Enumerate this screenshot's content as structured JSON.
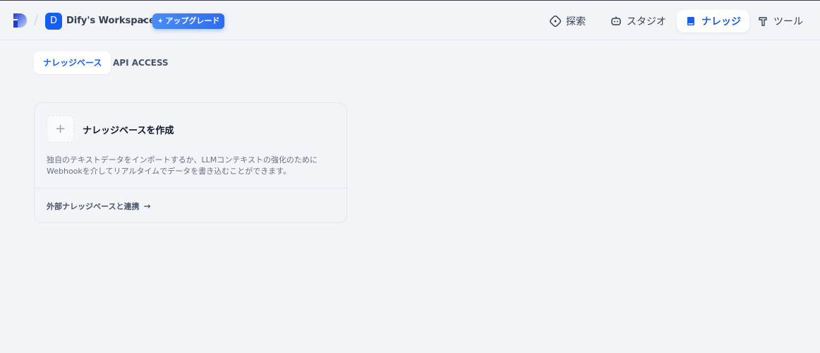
{
  "header": {
    "workspace_initial": "D",
    "workspace_name": "Dify's Workspace",
    "upgrade_label": "アップグレード",
    "nav": [
      {
        "label": "探索",
        "icon": "compass-icon",
        "active": false
      },
      {
        "label": "スタジオ",
        "icon": "robot-icon",
        "active": false
      },
      {
        "label": "ナレッジ",
        "icon": "book-icon",
        "active": true
      },
      {
        "label": "ツール",
        "icon": "hammer-icon",
        "active": false
      }
    ]
  },
  "tabs": [
    {
      "label": "ナレッジベース",
      "active": true
    },
    {
      "label": "API ACCESS",
      "active": false
    }
  ],
  "create_card": {
    "plus": "+",
    "title": "ナレッジベースを作成",
    "description": "独自のテキストデータをインポートするか、LLMコンテキストの強化のためにWebhookを介してリアルタイムでデータを書き込むことができます。",
    "link_label": "外部ナレッジベースと連携",
    "link_arrow": "→"
  },
  "colors": {
    "accent": "#155eef",
    "background": "#f2f4f7"
  }
}
